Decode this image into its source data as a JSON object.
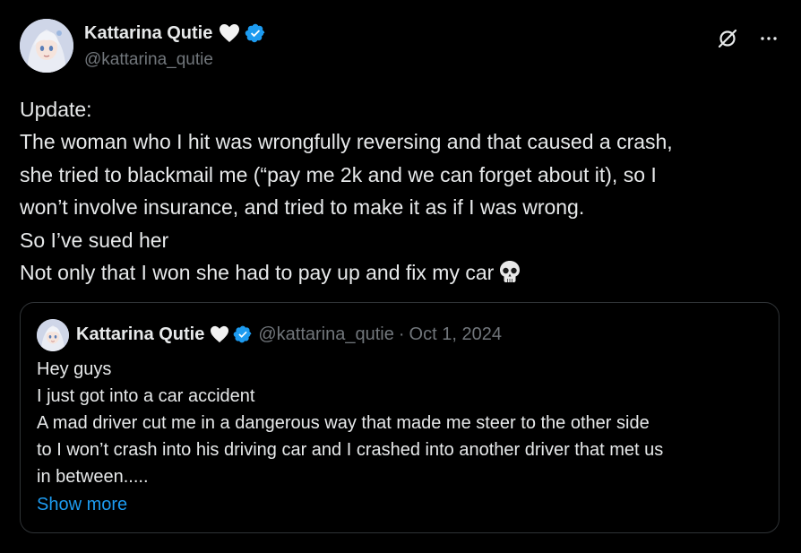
{
  "author": {
    "display_name": "Kattarina Qutie",
    "handle": "@kattarina_qutie",
    "emoji_badge": "white-heart-icon",
    "verified": true
  },
  "actions": {
    "grok_icon": "grok-icon",
    "more_icon": "more-options-icon"
  },
  "tweet": {
    "lines": [
      "Update:",
      "The woman who I hit was wrongfully reversing and that caused a crash,",
      "she tried to blackmail me (“pay me 2k and we can forget about it), so I",
      "won’t involve insurance, and tried to make it as if I was wrong.",
      "So I’ve sued her",
      "Not only that I won she had to pay up and fix my car"
    ],
    "trailing_emoji": "skull-icon"
  },
  "quote": {
    "display_name": "Kattarina Qutie",
    "handle": "@kattarina_qutie",
    "separator": "·",
    "date": "Oct 1, 2024",
    "lines": [
      "Hey guys",
      "I just got into a car accident",
      "A mad driver cut me in a dangerous way that made me steer to the other side",
      "to I won’t crash into his driving car and I crashed into another driver that met us",
      "in between....."
    ],
    "show_more_label": "Show more"
  },
  "colors": {
    "background": "#000000",
    "text_primary": "#e7e9ea",
    "text_secondary": "#71767b",
    "link": "#1d9bf0",
    "verified": "#1d9bf0",
    "border": "#2f3336"
  }
}
